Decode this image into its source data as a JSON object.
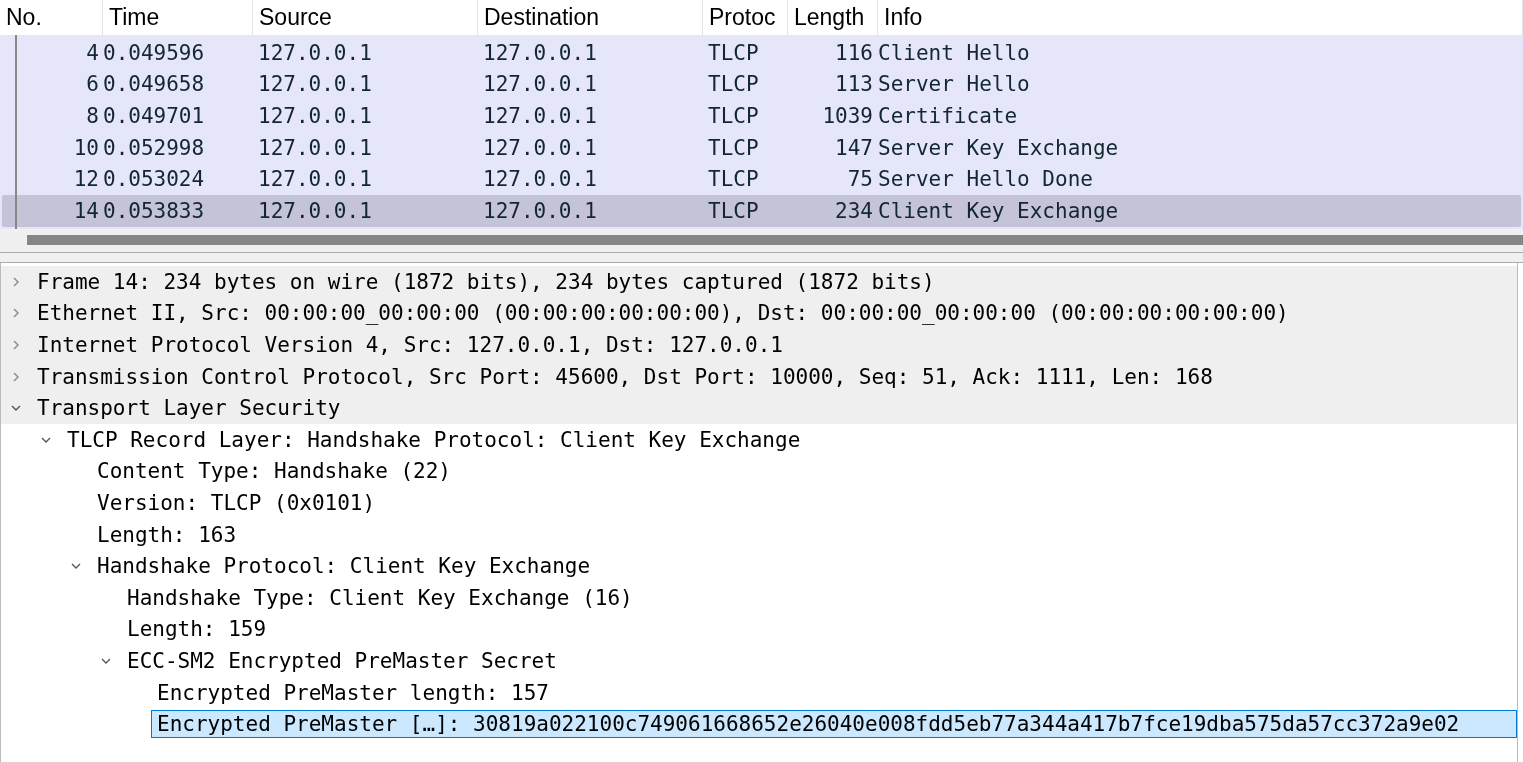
{
  "packet_list": {
    "columns": [
      "No.",
      "Time",
      "Source",
      "Destination",
      "Protoc",
      "Length",
      "Info"
    ],
    "rows": [
      {
        "no": "4",
        "time": "0.049596",
        "source": "127.0.0.1",
        "destination": "127.0.0.1",
        "protocol": "TLCP",
        "length": "116",
        "info": "Client Hello",
        "selected": false
      },
      {
        "no": "6",
        "time": "0.049658",
        "source": "127.0.0.1",
        "destination": "127.0.0.1",
        "protocol": "TLCP",
        "length": "113",
        "info": "Server Hello",
        "selected": false
      },
      {
        "no": "8",
        "time": "0.049701",
        "source": "127.0.0.1",
        "destination": "127.0.0.1",
        "protocol": "TLCP",
        "length": "1039",
        "info": "Certificate",
        "selected": false
      },
      {
        "no": "10",
        "time": "0.052998",
        "source": "127.0.0.1",
        "destination": "127.0.0.1",
        "protocol": "TLCP",
        "length": "147",
        "info": "Server Key Exchange",
        "selected": false
      },
      {
        "no": "12",
        "time": "0.053024",
        "source": "127.0.0.1",
        "destination": "127.0.0.1",
        "protocol": "TLCP",
        "length": "75",
        "info": "Server Hello Done",
        "selected": false
      },
      {
        "no": "14",
        "time": "0.053833",
        "source": "127.0.0.1",
        "destination": "127.0.0.1",
        "protocol": "TLCP",
        "length": "234",
        "info": "Client Key Exchange",
        "selected": true
      }
    ]
  },
  "details": [
    {
      "text": "Frame 14: 234 bytes on wire (1872 bits), 234 bytes captured (1872 bits)",
      "expanded": false,
      "selected": false
    },
    {
      "text": "Ethernet II, Src: 00:00:00_00:00:00 (00:00:00:00:00:00), Dst: 00:00:00_00:00:00 (00:00:00:00:00:00)",
      "expanded": false,
      "selected": false
    },
    {
      "text": "Internet Protocol Version 4, Src: 127.0.0.1, Dst: 127.0.0.1",
      "expanded": false,
      "selected": false
    },
    {
      "text": "Transmission Control Protocol, Src Port: 45600, Dst Port: 10000, Seq: 51, Ack: 1111, Len: 168",
      "expanded": false,
      "selected": false
    },
    {
      "text": "Transport Layer Security",
      "expanded": true,
      "selected": false,
      "children": [
        {
          "text": "TLCP Record Layer: Handshake Protocol: Client Key Exchange",
          "expanded": true,
          "selected": false,
          "children": [
            {
              "text": "Content Type: Handshake (22)",
              "selected": false
            },
            {
              "text": "Version: TLCP (0x0101)",
              "selected": false
            },
            {
              "text": "Length: 163",
              "selected": false
            },
            {
              "text": "Handshake Protocol: Client Key Exchange",
              "expanded": true,
              "selected": false,
              "children": [
                {
                  "text": "Handshake Type: Client Key Exchange (16)",
                  "selected": false
                },
                {
                  "text": "Length: 159",
                  "selected": false
                },
                {
                  "text": "ECC-SM2 Encrypted PreMaster Secret",
                  "expanded": true,
                  "selected": false,
                  "children": [
                    {
                      "text": "Encrypted PreMaster length: 157",
                      "selected": false
                    },
                    {
                      "text": "Encrypted PreMaster […]: 30819a022100c749061668652e26040e008fdd5eb77a344a417b7fce19dba575da57cc372a9e02",
                      "selected": true
                    }
                  ]
                }
              ]
            }
          ]
        }
      ]
    }
  ]
}
